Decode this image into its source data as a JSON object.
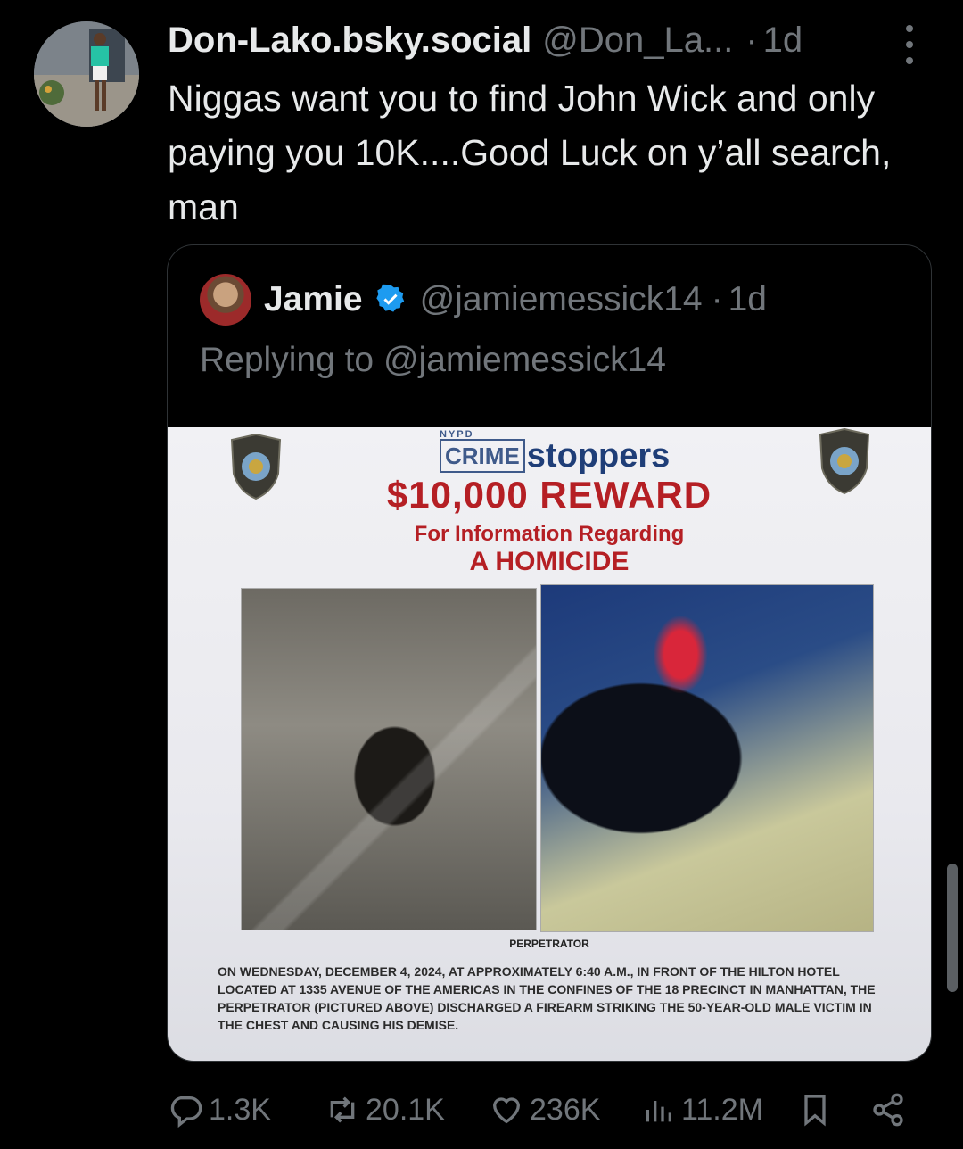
{
  "tweet": {
    "display_name": "Don-Lako.bsky.social",
    "handle": "@Don_La...",
    "dot": "·",
    "time": "1d",
    "text": "Niggas want you to find John Wick and only paying you 10K....Good Luck on y’all search, man"
  },
  "quote": {
    "name": "Jamie",
    "handle": "@jamiemessick14",
    "dot": "·",
    "time": "1d",
    "replying_to": "Replying to @jamiemessick14",
    "poster": {
      "nypd": "NYPD",
      "crime": "CRIME",
      "stoppers": "stoppers",
      "reward": "$10,000 REWARD",
      "info": "For Information Regarding",
      "homicide": "A HOMICIDE",
      "perpetrator": "PERPETRATOR",
      "description": "ON WEDNESDAY, DECEMBER 4, 2024, AT APPROXIMATELY 6:40 A.M., IN FRONT OF THE HILTON HOTEL LOCATED AT 1335 AVENUE OF THE AMERICAS IN THE CONFINES OF THE 18 PRECINCT IN MANHATTAN, THE PERPETRATOR (PICTURED ABOVE) DISCHARGED A FIREARM STRIKING THE 50-YEAR-OLD MALE VICTIM IN THE CHEST AND CAUSING HIS DEMISE."
    }
  },
  "actions": {
    "replies": "1.3K",
    "reposts": "20.1K",
    "likes": "236K",
    "views": "11.2M"
  },
  "colors": {
    "background": "#000000",
    "text": "#e7e9ea",
    "muted": "#71767b",
    "verified": "#1d9bf0",
    "reward_red": "#b51f24"
  },
  "icons": [
    "more-icon",
    "verified-badge-icon",
    "reply-icon",
    "repost-icon",
    "like-icon",
    "views-icon",
    "bookmark-icon",
    "share-icon",
    "police-badge-icon"
  ]
}
